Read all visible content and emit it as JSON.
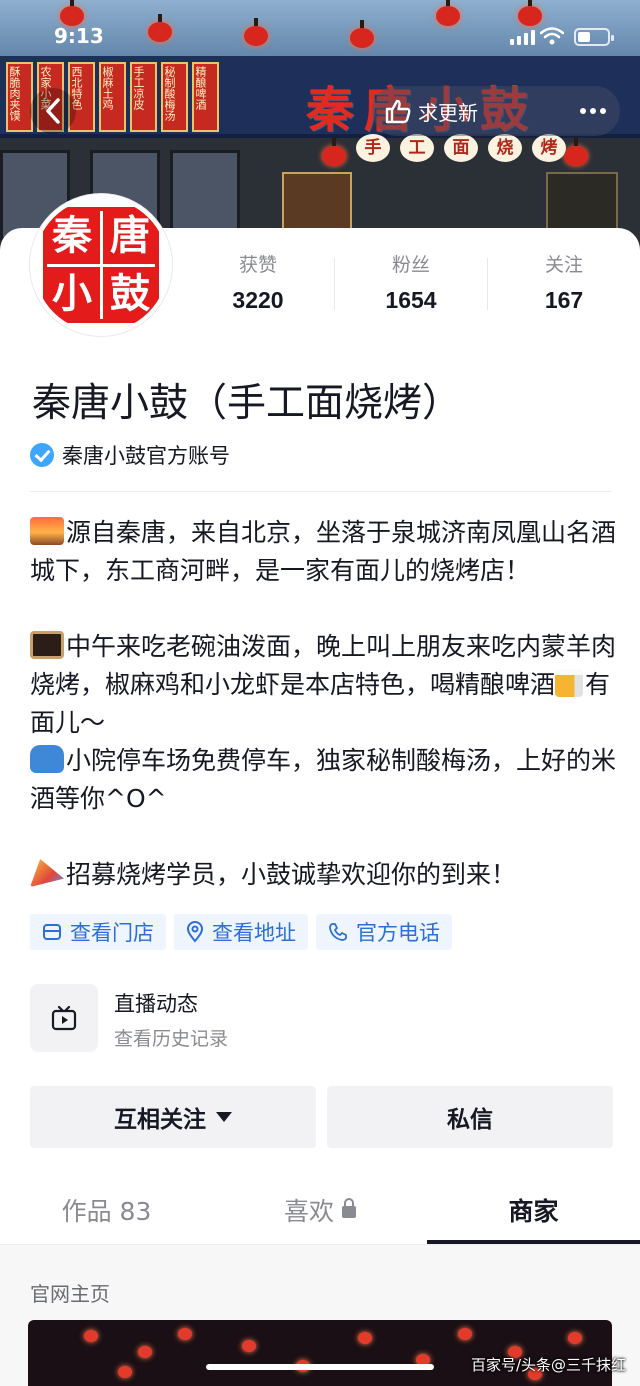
{
  "status_bar": {
    "time": "9:13"
  },
  "header": {
    "update_label": "求更新",
    "shop_sign": "秦唐小鼓",
    "shop_tag_chars": [
      "手",
      "工",
      "面",
      "烧",
      "烤"
    ],
    "side_banners": [
      "酥脆肉夹馍",
      "农家小菜",
      "西北特色",
      "椒麻土鸡",
      "手工凉皮",
      "秘制酸梅汤",
      "精酿啤酒"
    ]
  },
  "profile": {
    "avatar_chars": [
      "秦",
      "唐",
      "小",
      "鼓"
    ],
    "stats": [
      {
        "label": "获赞",
        "value": "3220"
      },
      {
        "label": "粉丝",
        "value": "1654"
      },
      {
        "label": "关注",
        "value": "167"
      }
    ],
    "name": "秦唐小鼓（手工面烧烤）",
    "verified_label": "秦唐小鼓官方账号",
    "bio": {
      "p1": "源自秦唐，来自北京，坐落于泉城济南凤凰山名酒城下，东工商河畔，是一家有面儿的烧烤店！",
      "p2a": "中午来吃老碗油泼面，晚上叫上朋友来吃内蒙羊肉烧烤，椒麻鸡和小龙虾是本店特色，喝精酿啤酒",
      "p2b": "有面儿～",
      "p3": "小院停车场免费停车，独家秘制酸梅汤，上好的米酒等你^O^",
      "p4": "招募烧烤学员，小鼓诚挚欢迎你的到来！"
    },
    "chips": [
      {
        "label": "查看门店",
        "icon": "store-icon"
      },
      {
        "label": "查看地址",
        "icon": "location-pin-icon"
      },
      {
        "label": "官方电话",
        "icon": "phone-icon"
      }
    ],
    "live": {
      "title": "直播动态",
      "subtitle": "查看历史记录"
    },
    "actions": {
      "follow_label": "互相关注",
      "message_label": "私信"
    }
  },
  "tabs": {
    "works_label": "作品 83",
    "likes_label": "喜欢",
    "store_label": "商家",
    "active": "商家"
  },
  "store_section": {
    "title": "官网主页"
  },
  "watermark": "百家号/头条@三千抹红",
  "colors": {
    "accent_blue": "#2d6fd6",
    "verified_blue": "#3ea6ff",
    "seal_red": "#e31b1b",
    "text": "#161823",
    "muted": "#8a8b91"
  }
}
